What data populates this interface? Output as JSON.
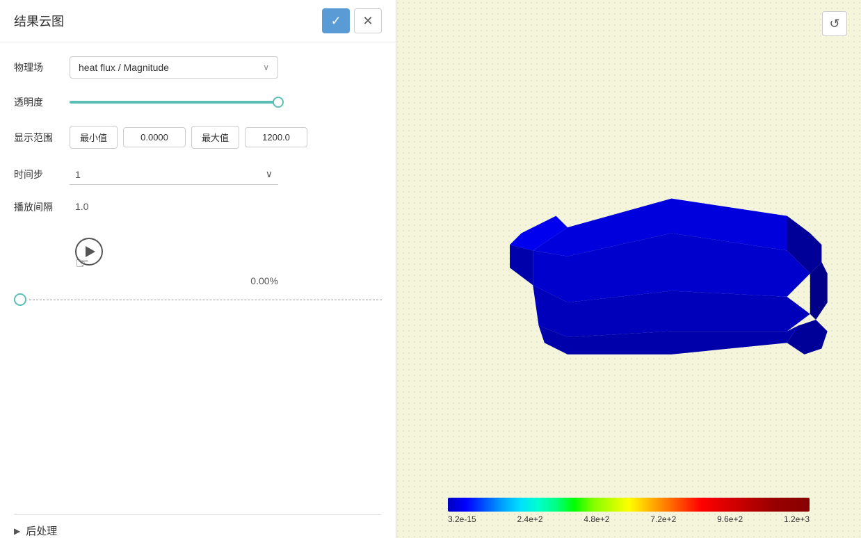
{
  "panel": {
    "title": "结果云图",
    "confirm_label": "✓",
    "cancel_label": "✕"
  },
  "form": {
    "physics_label": "物理场",
    "physics_value": "heat flux / Magnitude",
    "transparency_label": "透明度",
    "range_label": "显示范围",
    "min_label": "最小值",
    "min_value": "0.0000",
    "max_label": "最大值",
    "max_value": "1200.0",
    "timestep_label": "时间步",
    "timestep_value": "1",
    "interval_label": "播放间隔",
    "interval_value": "1.0",
    "progress_text": "0.00%"
  },
  "post": {
    "title": "后处理",
    "arrow": "▶"
  },
  "colorbar": {
    "labels": [
      "3.2e-15",
      "2.4e+2",
      "4.8e+2",
      "7.2e+2",
      "9.6e+2",
      "1.2e+3"
    ]
  },
  "toolbar": {
    "refresh_icon": "↺"
  }
}
